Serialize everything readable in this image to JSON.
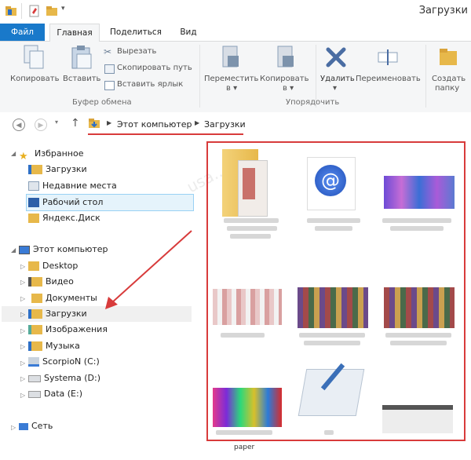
{
  "window": {
    "title": "Загрузки"
  },
  "tabs": {
    "file": "Файл",
    "home": "Главная",
    "share": "Поделиться",
    "view": "Вид"
  },
  "ribbon": {
    "copy": "Копировать",
    "paste": "Вставить",
    "cut": "Вырезать",
    "copy_path": "Скопировать путь",
    "paste_shortcut": "Вставить ярлык",
    "clipboard_group": "Буфер обмена",
    "move_to": "Переместить",
    "move_to_arrow": "в ▾",
    "copy_to": "Копировать",
    "copy_to_arrow": "в ▾",
    "delete": "Удалить",
    "delete_arrow": "▾",
    "rename": "Переименовать",
    "new_folder_1": "Создать",
    "new_folder_2": "папку",
    "organize_group": "Упорядочить"
  },
  "address": {
    "crumb1": "Этот компьютер",
    "crumb2": "Загрузки"
  },
  "tree": {
    "favorites": "Избранное",
    "downloads_fav": "Загрузки",
    "recent": "Недавние места",
    "desktop_fav": "Рабочий стол",
    "yandex": "Яндекс.Диск",
    "this_pc": "Этот компьютер",
    "desktop": "Desktop",
    "video": "Видео",
    "documents": "Документы",
    "downloads": "Загрузки",
    "images": "Изображения",
    "music": "Музыка",
    "drive_c": "ScorpioN (C:)",
    "drive_d": "Systema (D:)",
    "drive_e": "Data (E:)",
    "network": "Сеть"
  },
  "files": {
    "bottom_caption": "paper"
  },
  "watermark": "usa...ru",
  "colors": {
    "file_tab": "#1979ca",
    "highlight": "#d83b3b",
    "selection": "#e5f3fb"
  }
}
